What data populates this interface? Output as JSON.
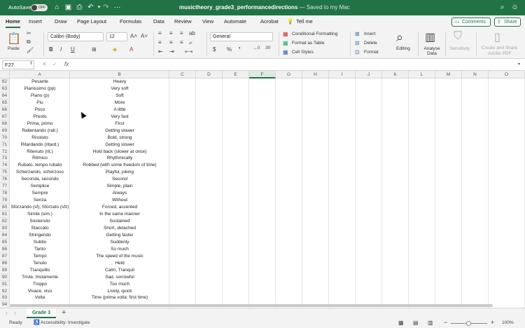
{
  "titlebar": {
    "autosave_label": "AutoSave",
    "autosave_state": "OFF",
    "filename": "musictheory_grade3_performancedirections",
    "saved_status": "— Saved to my Mac",
    "icons": [
      "home-icon",
      "save-icon",
      "print-icon",
      "undo-icon",
      "redo-icon",
      "more-icon",
      "search-icon",
      "account-icon"
    ]
  },
  "ribbon_tabs": [
    "Home",
    "Insert",
    "Draw",
    "Page Layout",
    "Formulas",
    "Data",
    "Review",
    "View",
    "Automate",
    "Acrobat"
  ],
  "tell_me": "Tell me",
  "comments_label": "Comments",
  "share_label": "Share",
  "ribbon": {
    "paste_label": "Paste",
    "font_name": "Calibri (Body)",
    "font_size": "12",
    "number_format": "General",
    "conditional_formatting": "Conditional Formatting",
    "format_as_table": "Format as Table",
    "cell_styles": "Cell Styles",
    "insert": "Insert",
    "delete": "Delete",
    "format": "Format",
    "editing": "Editing",
    "analyse_data": "Analyse Data",
    "sensitivity": "Sensitivity",
    "create_share_pdf_1": "Create and Share",
    "create_share_pdf_2": "Adobe PDF"
  },
  "formula_bar": {
    "name_box": "F27",
    "fx": "fx",
    "value": ""
  },
  "columns": [
    "A",
    "B",
    "C",
    "D",
    "E",
    "F",
    "G",
    "H",
    "I",
    "J",
    "K",
    "L",
    "M",
    "N",
    "O"
  ],
  "selected_column": "F",
  "rows": [
    {
      "n": "62",
      "a": "Pesante",
      "b": "Heavy"
    },
    {
      "n": "63",
      "a": "Pianissimo (pp)",
      "b": "Very soft"
    },
    {
      "n": "64",
      "a": "Piano (p)",
      "b": "Soft"
    },
    {
      "n": "65",
      "a": "Piu",
      "b": "More"
    },
    {
      "n": "66",
      "a": "Poco",
      "b": "A little"
    },
    {
      "n": "67",
      "a": "Presto",
      "b": "Very fast"
    },
    {
      "n": "68",
      "a": "Prima, primo",
      "b": "First"
    },
    {
      "n": "69",
      "a": "Rallentando (rall.)",
      "b": "Getting slower"
    },
    {
      "n": "70",
      "a": "Risoluto",
      "b": "Bold, strong"
    },
    {
      "n": "71",
      "a": "Ritardando (ritard.)",
      "b": "Getting slower"
    },
    {
      "n": "72",
      "a": "Ritenuto (rit.)",
      "b": "Hold back (slower at once)"
    },
    {
      "n": "73",
      "a": "Ritmico",
      "b": "Rhythmically"
    },
    {
      "n": "74",
      "a": "Rubato, tempo rubato",
      "b": "Robbed (with some freedom of time)"
    },
    {
      "n": "75",
      "a": "Scherzando, scherzoso",
      "b": "Playful, joking"
    },
    {
      "n": "76",
      "a": "Seconda, secondo",
      "b": "Second"
    },
    {
      "n": "77",
      "a": "Semplice",
      "b": "Simple, plain"
    },
    {
      "n": "78",
      "a": "Sempre",
      "b": "Always"
    },
    {
      "n": "79",
      "a": "Senza",
      "b": "Without"
    },
    {
      "n": "80",
      "a": "Sforzando (sf), Sforzato (sfz)",
      "b": "Forced, accented"
    },
    {
      "n": "81",
      "a": "Simile (sim.)",
      "b": "In the same manner"
    },
    {
      "n": "82",
      "a": "Sostenuto",
      "b": "Sustained"
    },
    {
      "n": "83",
      "a": "Staccato",
      "b": "Short, detached"
    },
    {
      "n": "84",
      "a": "Stringendo",
      "b": "Getting faster"
    },
    {
      "n": "85",
      "a": "Subito",
      "b": "Suddenly"
    },
    {
      "n": "86",
      "a": "Tanto",
      "b": "So much"
    },
    {
      "n": "87",
      "a": "Tempo",
      "b": "The speed of the music"
    },
    {
      "n": "88",
      "a": "Tenuto",
      "b": "Held"
    },
    {
      "n": "89",
      "a": "Tranquillo",
      "b": "Calm, Tranquil"
    },
    {
      "n": "90",
      "a": "Triste, tristamente",
      "b": "Sad, sorrowful"
    },
    {
      "n": "91",
      "a": "Troppo",
      "b": "Too much"
    },
    {
      "n": "92",
      "a": "Vivace, vivo",
      "b": "Lively, quick"
    },
    {
      "n": "93",
      "a": "Volta",
      "b": "Time (prima volta: first time)"
    },
    {
      "n": "94",
      "a": "",
      "b": ""
    }
  ],
  "sheet_tab": "Grade 3",
  "add_sheet": "+",
  "status": {
    "ready": "Ready",
    "accessibility": "Accessibility: Investigate",
    "zoom": "100%"
  },
  "colors": {
    "accent": "#217346",
    "selected_column": "#e0e8e2"
  }
}
